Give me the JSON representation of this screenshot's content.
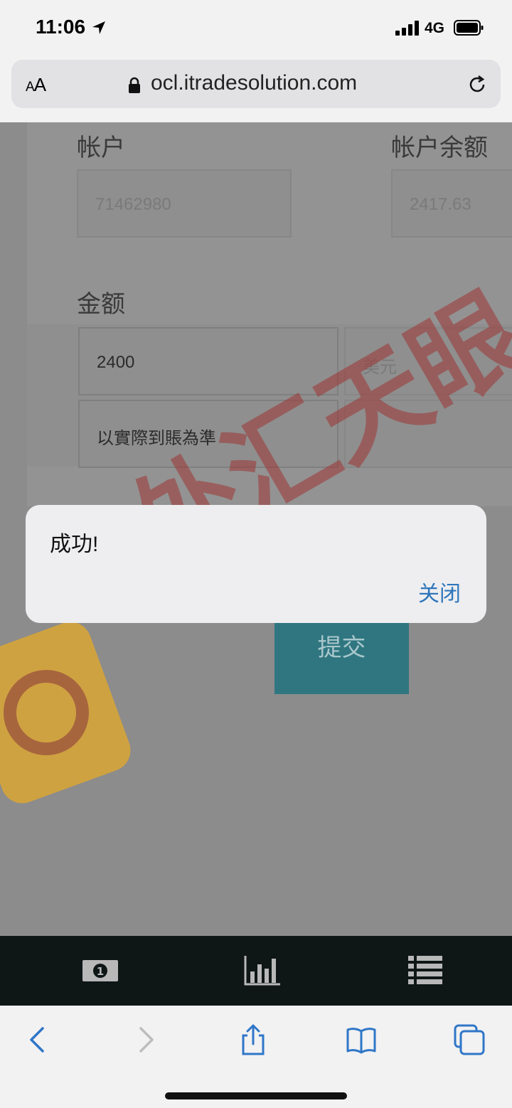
{
  "status_bar": {
    "time": "11:06",
    "network": "4G"
  },
  "browser": {
    "text_size_label": "AA",
    "url": "ocl.itradesolution.com"
  },
  "form": {
    "account_label": "帐户",
    "account_value": "71462980",
    "balance_label": "帐户余额",
    "balance_value": "2417.63",
    "amount_label": "金额",
    "amount_value": "2400",
    "currency_value": "美元",
    "note_value": "以實際到賬為準",
    "submit_label": "提交"
  },
  "alert": {
    "message": "成功!",
    "close_label": "关闭"
  },
  "watermark": {
    "text": "外汇天眼 APP"
  },
  "colors": {
    "accent": "#2f76bb",
    "submit_bg": "#2f7680",
    "nav_bg": "#0f1616"
  },
  "app_nav": {
    "icons": [
      "money-icon",
      "chart-icon",
      "list-icon"
    ]
  },
  "safari_toolbar": {
    "icons": [
      "back-icon",
      "forward-icon",
      "share-icon",
      "bookmarks-icon",
      "tabs-icon"
    ]
  }
}
